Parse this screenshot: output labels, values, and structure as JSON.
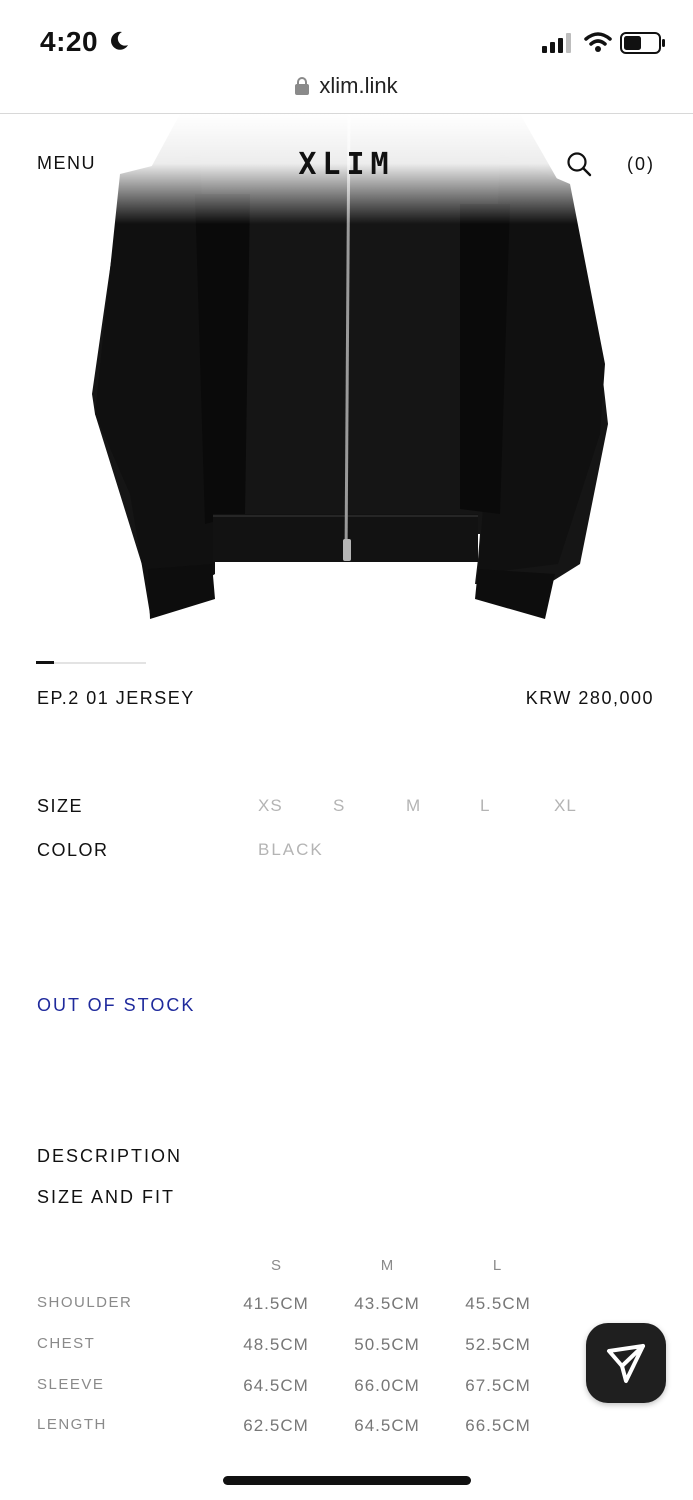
{
  "status_bar": {
    "time": "4:20"
  },
  "browser": {
    "url": "xlim.link"
  },
  "header": {
    "menu_label": "MENU",
    "logo_text": "XLIM",
    "cart_label": "(0)"
  },
  "product": {
    "title": "EP.2 01 JERSEY",
    "price": "KRW 280,000",
    "image_position": 1,
    "image_count": 6
  },
  "options": {
    "size_label": "SIZE",
    "sizes": [
      "XS",
      "S",
      "M",
      "L",
      "XL"
    ],
    "color_label": "COLOR",
    "colors": [
      "BLACK"
    ]
  },
  "stock_status": "OUT OF STOCK",
  "sections": {
    "description": "DESCRIPTION",
    "size_and_fit": "SIZE AND FIT"
  },
  "size_chart": {
    "columns": [
      "S",
      "M",
      "L"
    ],
    "rows": [
      {
        "label": "SHOULDER",
        "values": [
          "41.5CM",
          "43.5CM",
          "45.5CM"
        ]
      },
      {
        "label": "CHEST",
        "values": [
          "48.5CM",
          "50.5CM",
          "52.5CM"
        ]
      },
      {
        "label": "SLEEVE",
        "values": [
          "64.5CM",
          "66.0CM",
          "67.5CM"
        ]
      },
      {
        "label": "LENGTH",
        "values": [
          "62.5CM",
          "64.5CM",
          "66.5CM"
        ]
      }
    ]
  },
  "icons": {
    "status": [
      "moon-icon",
      "signal-icon",
      "wifi-icon",
      "battery-icon"
    ],
    "lock": "lock-icon",
    "search": "search-icon",
    "fab": "send-icon"
  },
  "colors": {
    "stock_status": "#1f2a9c",
    "fab": "#1f1f1f",
    "option_muted": "#b4b4b4"
  }
}
